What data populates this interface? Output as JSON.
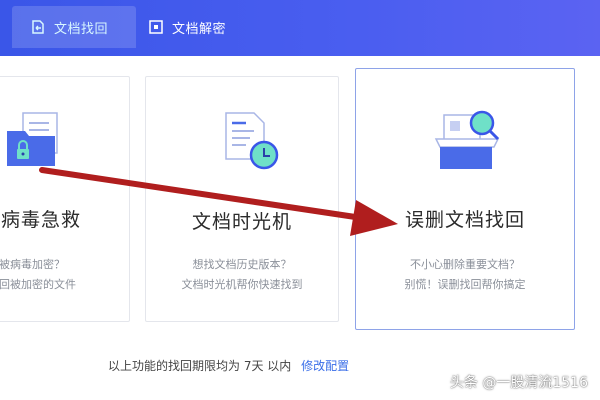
{
  "header": {
    "tabs": [
      {
        "label": "文档找回",
        "active": true
      },
      {
        "label": "文档解密",
        "active": false
      }
    ]
  },
  "cards": [
    {
      "title": "索病毒急救",
      "desc_line1": "被病毒加密？",
      "desc_line2": "回被加密的文件",
      "icon": "folder-lock-icon"
    },
    {
      "title": "文档时光机",
      "desc_line1": "想找文档历史版本？",
      "desc_line2": "文档时光机帮你快速找到",
      "icon": "document-clock-icon"
    },
    {
      "title": "误删文档找回",
      "desc_line1": "不小心删除重要文档？",
      "desc_line2": "别慌！误删找回帮你搞定",
      "icon": "box-search-icon",
      "selected": true
    }
  ],
  "footer": {
    "text": "以上功能的找回期限均为 7天 以内",
    "link": "修改配置"
  },
  "watermark": "头条 @一股清流1516",
  "colors": {
    "header": "#4a5ef0",
    "accent": "#3a6ee8",
    "arrow": "#b01e1e",
    "mint": "#6fe0c8"
  }
}
